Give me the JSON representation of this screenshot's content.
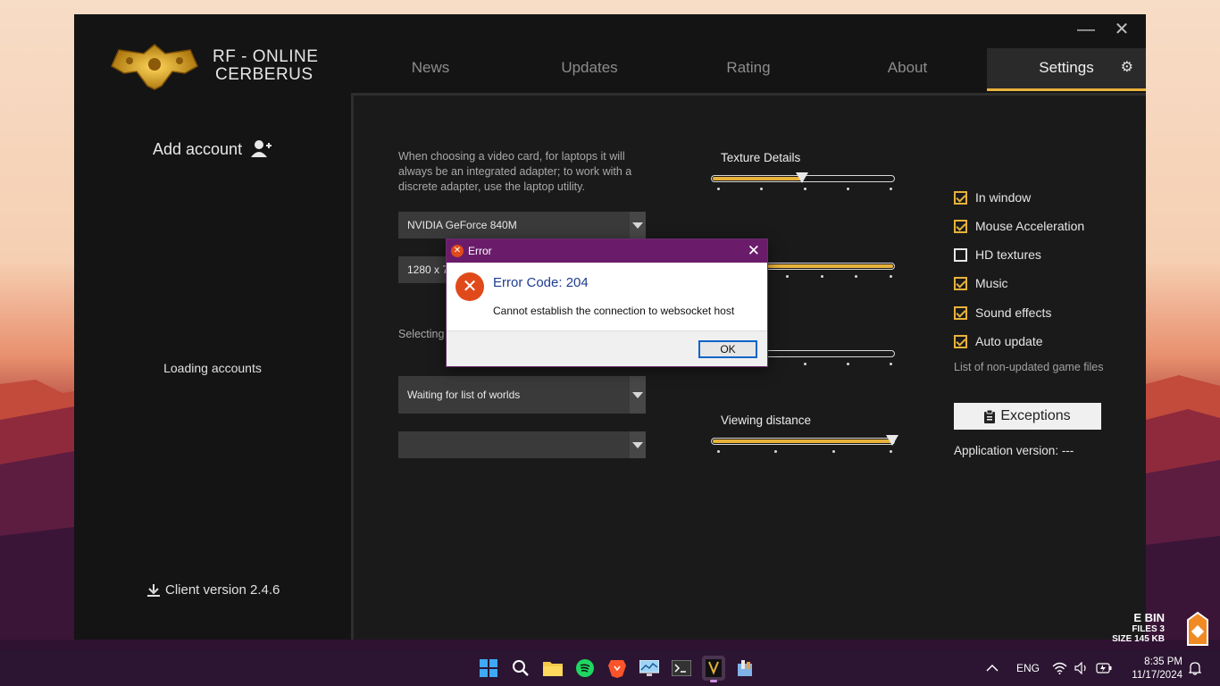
{
  "window": {
    "brand_line1": "RF - ONLINE",
    "brand_line2": "CERBERUS",
    "minimize_glyph": "—",
    "close_glyph": "✕"
  },
  "nav": {
    "items": [
      {
        "label": "News"
      },
      {
        "label": "Updates"
      },
      {
        "label": "Rating"
      },
      {
        "label": "About"
      },
      {
        "label": "Settings"
      }
    ],
    "active": "Settings"
  },
  "left": {
    "add_account": "Add account",
    "loading": "Loading accounts",
    "client_version": "Client version 2.4.6"
  },
  "settings": {
    "gpu_hint": "When choosing a video card, for laptops it will always be an integrated adapter; to work with a discrete adapter, use the laptop utility.",
    "gpu_value": "NVIDIA GeForce 840M",
    "resolution_value": "1280 x 7",
    "server_hint": "Selecting response",
    "world_value": "Waiting for list of worlds",
    "empty_value": "",
    "sliders": [
      {
        "label": "Texture Details",
        "value": 0.5
      },
      {
        "label": "",
        "value": 1.0
      },
      {
        "label": "",
        "value": 0.0
      },
      {
        "label": "Viewing distance",
        "value": 1.0
      }
    ],
    "checkboxes": [
      {
        "label": "In window",
        "checked": true
      },
      {
        "label": "Mouse Acceleration",
        "checked": true
      },
      {
        "label": "HD textures",
        "checked": false
      },
      {
        "label": "Music",
        "checked": true
      },
      {
        "label": "Sound effects",
        "checked": true
      },
      {
        "label": "Auto update",
        "checked": true
      }
    ],
    "files_label": "List of non-updated game files",
    "exceptions_label": "Exceptions",
    "app_version": "Application version: ---"
  },
  "dialog": {
    "title": "Error",
    "heading": "Error Code: 204",
    "message": "Cannot establish the connection to websocket host",
    "ok_label": "OK",
    "close_glyph": "✕"
  },
  "desktop_widget": {
    "line1": "E BIN",
    "line2": "FILES 3",
    "line3": "SIZE 145 KB"
  },
  "taskbar": {
    "language": "ENG",
    "time": "8:35 PM",
    "date": "11/17/2024"
  },
  "colors": {
    "accent": "#e8b23a",
    "dialog_title": "#6a1c6a",
    "error_red": "#e04a1b",
    "heading_blue": "#1f3d8f"
  }
}
